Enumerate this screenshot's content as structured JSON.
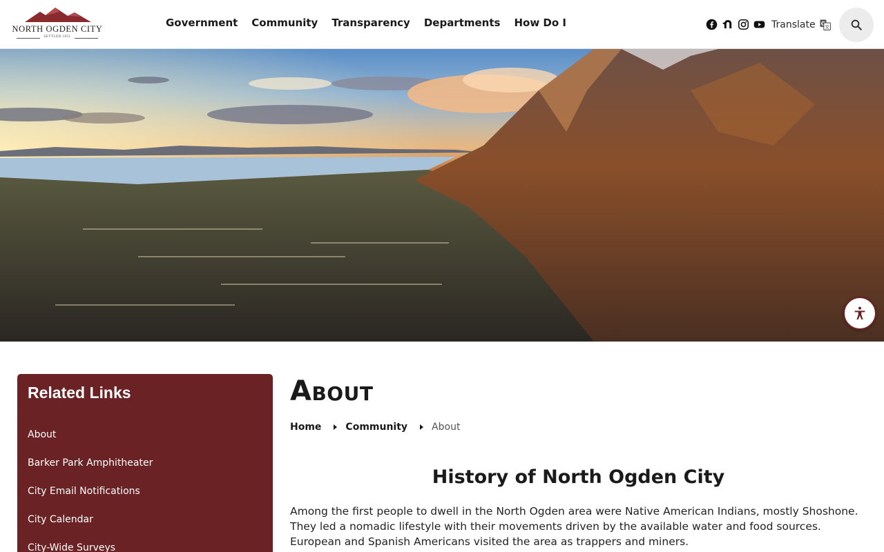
{
  "logo": {
    "name": "North Ogden City",
    "subtitle": "SETTLED 1851"
  },
  "nav": {
    "items": [
      {
        "label": "Government"
      },
      {
        "label": "Community"
      },
      {
        "label": "Transparency"
      },
      {
        "label": "Departments"
      },
      {
        "label": "How Do I"
      }
    ]
  },
  "header": {
    "social_icons": [
      "facebook-icon",
      "nextdoor-icon",
      "instagram-icon",
      "youtube-icon"
    ],
    "translate_label": "Translate",
    "search_icon": "search-icon"
  },
  "colors": {
    "brand": "#6b2225",
    "text": "#1a1a1a"
  },
  "sidebar": {
    "title": "Related Links",
    "links": [
      {
        "label": "About"
      },
      {
        "label": "Barker Park Amphitheater"
      },
      {
        "label": "City Email Notifications"
      },
      {
        "label": "City Calendar"
      },
      {
        "label": "City-Wide Surveys"
      }
    ]
  },
  "main": {
    "page_title": "About",
    "breadcrumb": {
      "home": "Home",
      "community": "Community",
      "current": "About"
    },
    "article_title": "History of North Ogden City",
    "article_body": "Among the first people to dwell in the North Ogden area were Native American Indians, mostly Shoshone. They led a nomadic lifestyle with their movements driven by the available water and food sources. European and Spanish Americans visited the area as trappers and miners."
  }
}
